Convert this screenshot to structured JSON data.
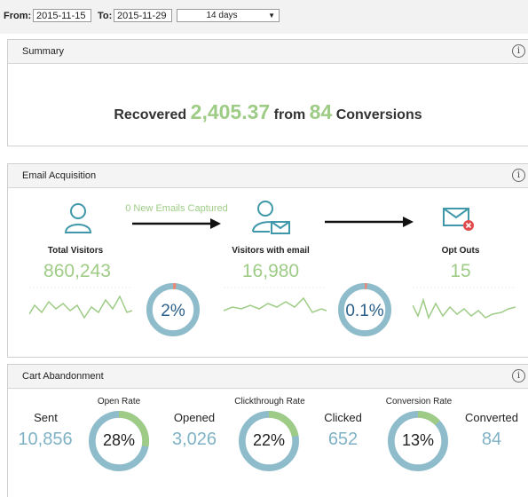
{
  "filters": {
    "from_label": "From:",
    "from_value": "2015-11-15",
    "to_label": "To:",
    "to_value": "2015-11-29",
    "range_value": "14 days"
  },
  "summary": {
    "title": "Summary",
    "recovered_label": "Recovered",
    "recovered_value": "2,405.37",
    "from_word": "from",
    "conversions_count": "84",
    "conversions_label": "Conversions"
  },
  "email_acquisition": {
    "title": "Email Acquisition",
    "captured_text": "0 New Emails Captured",
    "total_visitors_label": "Total Visitors",
    "total_visitors_value": "860,243",
    "visitors_email_label": "Visitors with email",
    "visitors_email_value": "16,980",
    "opt_outs_label": "Opt Outs",
    "opt_outs_value": "15",
    "capture_rate": "2%",
    "capture_rate_fraction": 0.02,
    "opt_out_rate": "0.1%",
    "opt_out_rate_fraction": 0.001
  },
  "cart_abandonment": {
    "title": "Cart Abandonment",
    "sent_label": "Sent",
    "sent_value": "10,856",
    "open_rate_label": "Open Rate",
    "open_rate": "28%",
    "open_rate_fraction": 0.28,
    "opened_label": "Opened",
    "opened_value": "3,026",
    "clickthrough_label": "Clickthrough Rate",
    "clickthrough_rate": "22%",
    "clickthrough_fraction": 0.22,
    "clicked_label": "Clicked",
    "clicked_value": "652",
    "conversion_rate_label": "Conversion Rate",
    "conversion_rate": "13%",
    "conversion_fraction": 0.13,
    "converted_label": "Converted",
    "converted_value": "84"
  },
  "colors": {
    "green": "#9ecc86",
    "blue": "#7fb2c5",
    "ring_blue": "#8ebccb",
    "ring_red": "#e88a7a",
    "icon_teal": "#3f98aa",
    "opt_out_red": "#e04b4b"
  }
}
